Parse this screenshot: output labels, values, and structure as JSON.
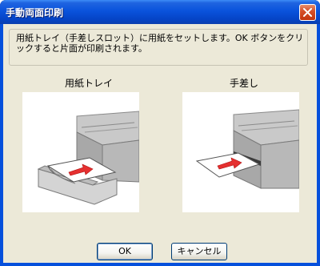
{
  "window": {
    "title": "手動両面印刷"
  },
  "message": "用紙トレイ（手差しスロット）に用紙をセットします。OK ボタンをクリックすると片面が印刷されます。",
  "options": [
    {
      "label": "用紙トレイ"
    },
    {
      "label": "手差し"
    }
  ],
  "buttons": {
    "ok": "OK",
    "cancel": "キャンセル"
  },
  "colors": {
    "title_bar": "#0a53dc",
    "dialog_bg": "#ece9d8",
    "close_button": "#d6512a",
    "arrow": "#e53030"
  }
}
